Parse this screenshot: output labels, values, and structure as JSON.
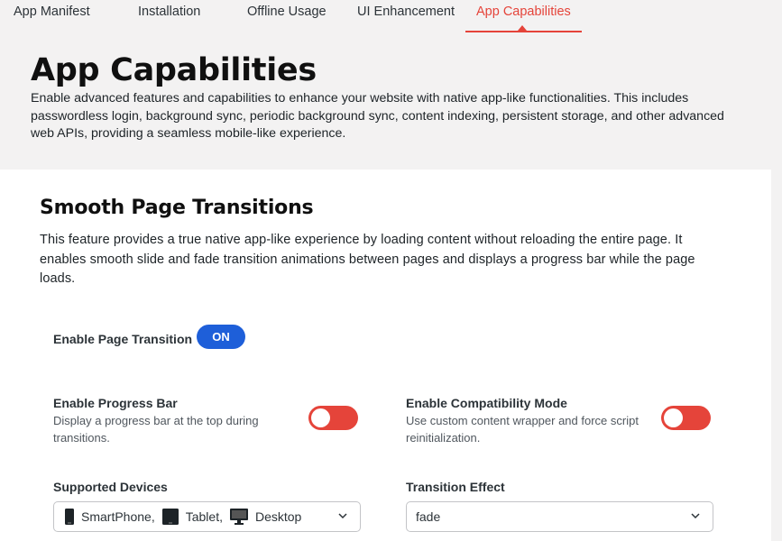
{
  "tabs": [
    {
      "label": "App Manifest",
      "active": false
    },
    {
      "label": "Installation",
      "active": false
    },
    {
      "label": "Offline Usage",
      "active": false
    },
    {
      "label": "UI Enhancement",
      "active": false
    },
    {
      "label": "App Capabilities",
      "active": true
    }
  ],
  "header": {
    "title": "App Capabilities",
    "description": "Enable advanced features and capabilities to enhance your website with native app-like functionalities. This includes passwordless login, background sync, periodic background sync, content indexing, persistent storage, and other advanced web APIs, providing a seamless mobile-like experience."
  },
  "section": {
    "title": "Smooth Page Transitions",
    "description": "This feature provides a true native app-like experience by loading content without reloading the entire page. It enables smooth slide and fade transition animations between pages and displays a progress bar while the page loads."
  },
  "settings": {
    "enable_transition": {
      "label": "Enable Page Transition",
      "state": "ON"
    },
    "progress_bar": {
      "label": "Enable Progress Bar",
      "description": "Display a progress bar at the top during transitions."
    },
    "compat_mode": {
      "label": "Enable Compatibility Mode",
      "description": "Use custom content wrapper and force script reinitialization."
    },
    "supported_devices": {
      "label": "Supported Devices",
      "items": [
        {
          "name": "SmartPhone,",
          "icon": "smartphone-icon"
        },
        {
          "name": "Tablet,",
          "icon": "tablet-icon"
        },
        {
          "name": "Desktop",
          "icon": "desktop-icon"
        }
      ]
    },
    "transition_effect": {
      "label": "Transition Effect",
      "value": "fade"
    }
  },
  "colors": {
    "accent": "#e5443a",
    "on_pill": "#1e5fd9"
  }
}
